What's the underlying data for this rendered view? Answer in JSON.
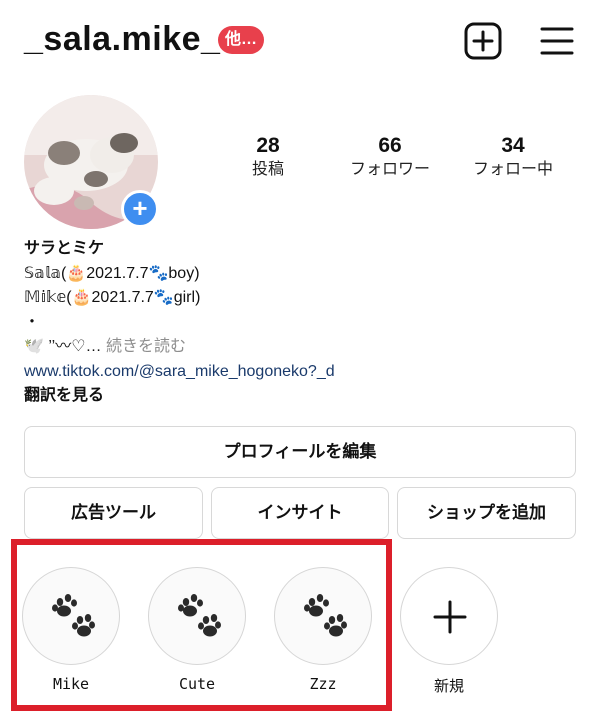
{
  "header": {
    "username": "_sala.mike_",
    "account_badge": "他…"
  },
  "stats": {
    "posts": {
      "count": "28",
      "label": "投稿"
    },
    "followers": {
      "count": "66",
      "label": "フォロワー"
    },
    "following": {
      "count": "34",
      "label": "フォロー中"
    }
  },
  "bio": {
    "name": "サラとミケ",
    "line1": "𝕊𝕒𝕝𝕒(🎂2021.7.7🐾boy)",
    "line2": "𝕄𝕚𝕜𝕖(🎂2021.7.7🐾girl)",
    "line3": "・",
    "line4_text": "🕊️ ’’〰♡…",
    "more": "続きを読む",
    "link": "www.tiktok.com/@sara_mike_hogoneko?_d",
    "translate": "翻訳を見る"
  },
  "buttons": {
    "edit_profile": "プロフィールを編集",
    "ad_tools": "広告ツール",
    "insights": "インサイト",
    "add_shop": "ショップを追加"
  },
  "highlights": [
    {
      "label": "Mike",
      "icon": "paw-icon"
    },
    {
      "label": "Cute",
      "icon": "paw-icon"
    },
    {
      "label": "Zzz",
      "icon": "paw-icon"
    },
    {
      "label": "新規",
      "icon": "plus-icon"
    }
  ],
  "colors": {
    "badge": "#e8404c",
    "avatar_plus": "#3f8ef0",
    "link": "#1a3a6b",
    "muted": "#8e8e8e",
    "highlight_annotation": "#dc1f2a"
  }
}
